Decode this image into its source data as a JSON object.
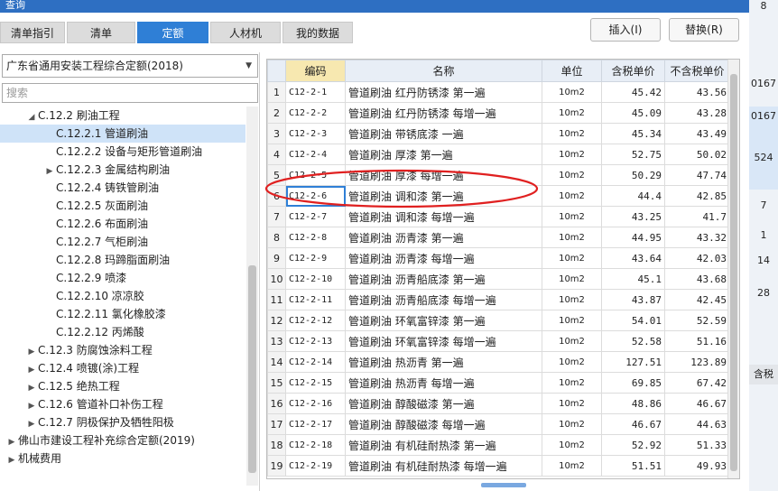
{
  "window": {
    "title": "查询"
  },
  "tabs": [
    {
      "label": "清单指引"
    },
    {
      "label": "清单"
    },
    {
      "label": "定额",
      "active": true
    },
    {
      "label": "人材机"
    },
    {
      "label": "我的数据"
    }
  ],
  "buttons": {
    "insert": "插入(I)",
    "replace": "替换(R)"
  },
  "library_select": {
    "value": "广东省通用安装工程综合定额(2018)"
  },
  "search": {
    "placeholder": "搜索"
  },
  "tree": [
    {
      "label": "C.12.2 刷油工程",
      "toggle": "◢",
      "level": 2
    },
    {
      "label": "C.12.2.1 管道刷油",
      "toggle": "",
      "level": 3,
      "selected": true
    },
    {
      "label": "C.12.2.2 设备与矩形管道刷油",
      "toggle": "",
      "level": 3
    },
    {
      "label": "C.12.2.3 金属结构刷油",
      "toggle": "▶",
      "level": 3
    },
    {
      "label": "C.12.2.4 铸铁管刷油",
      "toggle": "",
      "level": 3
    },
    {
      "label": "C.12.2.5 灰面刷油",
      "toggle": "",
      "level": 3
    },
    {
      "label": "C.12.2.6 布面刷油",
      "toggle": "",
      "level": 3
    },
    {
      "label": "C.12.2.7 气柜刷油",
      "toggle": "",
      "level": 3
    },
    {
      "label": "C.12.2.8 玛蹄脂面刷油",
      "toggle": "",
      "level": 3
    },
    {
      "label": "C.12.2.9 喷漆",
      "toggle": "",
      "level": 3
    },
    {
      "label": "C.12.2.10 凉凉胶",
      "toggle": "",
      "level": 3
    },
    {
      "label": "C.12.2.11 氯化橡胶漆",
      "toggle": "",
      "level": 3
    },
    {
      "label": "C.12.2.12 丙烯酸",
      "toggle": "",
      "level": 3
    },
    {
      "label": "C.12.3 防腐蚀涂料工程",
      "toggle": "▶",
      "level": 2
    },
    {
      "label": "C.12.4 喷镀(涂)工程",
      "toggle": "▶",
      "level": 2
    },
    {
      "label": "C.12.5 绝热工程",
      "toggle": "▶",
      "level": 2
    },
    {
      "label": "C.12.6 管道补口补伤工程",
      "toggle": "▶",
      "level": 2
    },
    {
      "label": "C.12.7 阴极保护及牺牲阳极",
      "toggle": "▶",
      "level": 2
    },
    {
      "label": "佛山市建设工程补充综合定额(2019)",
      "toggle": "▶",
      "level": 0
    },
    {
      "label": "机械费用",
      "toggle": "▶",
      "level": 0
    }
  ],
  "table": {
    "columns": [
      "",
      "编码",
      "名称",
      "单位",
      "含税单价",
      "不含税单价"
    ],
    "rows": [
      {
        "n": "1",
        "code": "C12-2-1",
        "name": "管道刷油 红丹防锈漆 第一遍",
        "unit": "10m2",
        "tax": "45.42",
        "notax": "43.56"
      },
      {
        "n": "2",
        "code": "C12-2-2",
        "name": "管道刷油 红丹防锈漆 每增一遍",
        "unit": "10m2",
        "tax": "45.09",
        "notax": "43.28"
      },
      {
        "n": "3",
        "code": "C12-2-3",
        "name": "管道刷油 带锈底漆 一遍",
        "unit": "10m2",
        "tax": "45.34",
        "notax": "43.49"
      },
      {
        "n": "4",
        "code": "C12-2-4",
        "name": "管道刷油 厚漆 第一遍",
        "unit": "10m2",
        "tax": "52.75",
        "notax": "50.02"
      },
      {
        "n": "5",
        "code": "C12-2-5",
        "name": "管道刷油 厚漆 每增一遍",
        "unit": "10m2",
        "tax": "50.29",
        "notax": "47.74"
      },
      {
        "n": "6",
        "code": "C12-2-6",
        "name": "管道刷油 调和漆 第一遍",
        "unit": "10m2",
        "tax": "44.4",
        "notax": "42.85",
        "active": true
      },
      {
        "n": "7",
        "code": "C12-2-7",
        "name": "管道刷油 调和漆 每增一遍",
        "unit": "10m2",
        "tax": "43.25",
        "notax": "41.7"
      },
      {
        "n": "8",
        "code": "C12-2-8",
        "name": "管道刷油 沥青漆 第一遍",
        "unit": "10m2",
        "tax": "44.95",
        "notax": "43.32"
      },
      {
        "n": "9",
        "code": "C12-2-9",
        "name": "管道刷油 沥青漆 每增一遍",
        "unit": "10m2",
        "tax": "43.64",
        "notax": "42.03"
      },
      {
        "n": "10",
        "code": "C12-2-10",
        "name": "管道刷油 沥青船底漆 第一遍",
        "unit": "10m2",
        "tax": "45.1",
        "notax": "43.68"
      },
      {
        "n": "11",
        "code": "C12-2-11",
        "name": "管道刷油 沥青船底漆 每增一遍",
        "unit": "10m2",
        "tax": "43.87",
        "notax": "42.45"
      },
      {
        "n": "12",
        "code": "C12-2-12",
        "name": "管道刷油 环氧富锌漆 第一遍",
        "unit": "10m2",
        "tax": "54.01",
        "notax": "52.59"
      },
      {
        "n": "13",
        "code": "C12-2-13",
        "name": "管道刷油 环氧富锌漆 每增一遍",
        "unit": "10m2",
        "tax": "52.58",
        "notax": "51.16"
      },
      {
        "n": "14",
        "code": "C12-2-14",
        "name": "管道刷油 热沥青 第一遍",
        "unit": "10m2",
        "tax": "127.51",
        "notax": "123.89"
      },
      {
        "n": "15",
        "code": "C12-2-15",
        "name": "管道刷油 热沥青 每增一遍",
        "unit": "10m2",
        "tax": "69.85",
        "notax": "67.42"
      },
      {
        "n": "16",
        "code": "C12-2-16",
        "name": "管道刷油 醇酸磁漆 第一遍",
        "unit": "10m2",
        "tax": "48.86",
        "notax": "46.67"
      },
      {
        "n": "17",
        "code": "C12-2-17",
        "name": "管道刷油 醇酸磁漆 每增一遍",
        "unit": "10m2",
        "tax": "46.67",
        "notax": "44.63"
      },
      {
        "n": "18",
        "code": "C12-2-18",
        "name": "管道刷油 有机硅耐热漆 第一遍",
        "unit": "10m2",
        "tax": "52.92",
        "notax": "51.33"
      },
      {
        "n": "19",
        "code": "C12-2-19",
        "name": "管道刷油 有机硅耐热漆 每增一遍",
        "unit": "10m2",
        "tax": "51.51",
        "notax": "49.93"
      }
    ]
  },
  "background_app": [
    "8",
    "0167",
    "0167",
    "524",
    "7",
    "1",
    "14",
    "28",
    "含税"
  ],
  "colors": {
    "accent": "#2f7fd6",
    "annotation": "#e02020",
    "selected_row": "#cfe3f8"
  }
}
